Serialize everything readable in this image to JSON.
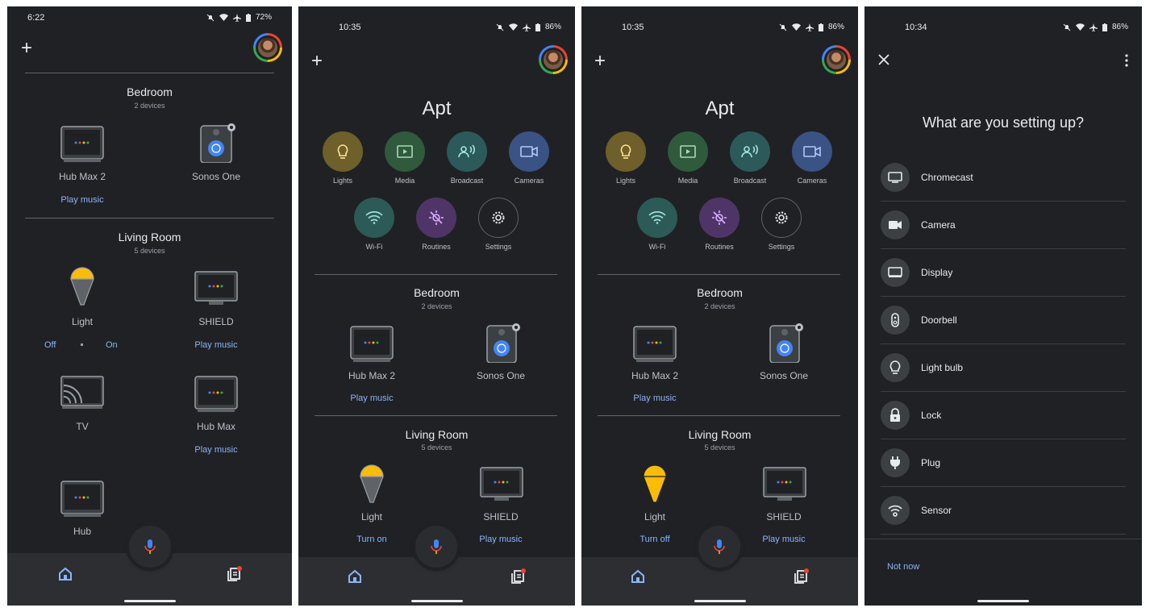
{
  "colors": {
    "bg": "#202124",
    "text": "#e8eaed",
    "muted": "#9aa0a6",
    "link": "#8ab4f8",
    "divider": "#5f6368",
    "nav": "#2d2e31"
  },
  "phone1": {
    "status": {
      "time": "6:22",
      "battery": "72%"
    },
    "rooms": [
      {
        "title": "Bedroom",
        "subtitle": "2 devices",
        "devices": [
          {
            "label": "Hub Max 2",
            "action": "Play music",
            "icon": "hub-display-icon"
          },
          {
            "label": "Sonos One",
            "action": "",
            "icon": "speaker-icon"
          }
        ]
      },
      {
        "title": "Living Room",
        "subtitle": "5 devices",
        "devices": [
          {
            "label": "Light",
            "off": "Off",
            "on": "On",
            "icon": "light-icon"
          },
          {
            "label": "SHIELD",
            "action": "Play music",
            "icon": "tv-box-icon"
          },
          {
            "label": "TV",
            "action": "",
            "icon": "cast-tv-icon"
          },
          {
            "label": "Hub Max",
            "action": "Play music",
            "icon": "hub-display-icon"
          },
          {
            "label": "Hub",
            "action": "",
            "icon": "hub-display-icon"
          }
        ]
      }
    ]
  },
  "phone2": {
    "status": {
      "time": "10:35",
      "battery": "86%"
    },
    "home_name": "Apt",
    "tiles": [
      {
        "label": "Lights",
        "color": "#7a6a2a",
        "icon": "bulb-icon"
      },
      {
        "label": "Media",
        "color": "#2e5a3c",
        "icon": "media-icon"
      },
      {
        "label": "Broadcast",
        "color": "#2a5a5a",
        "icon": "broadcast-icon"
      },
      {
        "label": "Cameras",
        "color": "#3a4f7a",
        "icon": "camera-icon"
      },
      {
        "label": "Wi-Fi",
        "color": "#2a5a56",
        "icon": "wifi-icon"
      },
      {
        "label": "Routines",
        "color": "#4e3466",
        "icon": "routines-icon"
      },
      {
        "label": "Settings",
        "color": "#202124",
        "icon": "gear-icon"
      }
    ],
    "bedroom": {
      "title": "Bedroom",
      "subtitle": "2 devices",
      "d1": "Hub Max 2",
      "d1_action": "Play music",
      "d2": "Sonos One"
    },
    "living": {
      "title": "Living Room",
      "subtitle": "5 devices",
      "d1": "Light",
      "d1_action": "Turn on",
      "d2": "SHIELD",
      "d2_action": "Play music"
    }
  },
  "phone3": {
    "status": {
      "time": "10:35",
      "battery": "86%"
    },
    "home_name": "Apt",
    "tiles": [
      {
        "label": "Lights"
      },
      {
        "label": "Media"
      },
      {
        "label": "Broadcast"
      },
      {
        "label": "Cameras"
      },
      {
        "label": "Wi-Fi"
      },
      {
        "label": "Routines"
      },
      {
        "label": "Settings"
      }
    ],
    "bedroom": {
      "title": "Bedroom",
      "subtitle": "2 devices",
      "d1": "Hub Max 2",
      "d1_action": "Play music",
      "d2": "Sonos One"
    },
    "living": {
      "title": "Living Room",
      "subtitle": "5 devices",
      "d1": "Light",
      "d1_action": "Turn off",
      "d2": "SHIELD",
      "d2_action": "Play music"
    }
  },
  "phone4": {
    "status": {
      "time": "10:34",
      "battery": "86%"
    },
    "heading": "What are you setting up?",
    "items": [
      {
        "label": "Chromecast",
        "icon": "tv-icon"
      },
      {
        "label": "Camera",
        "icon": "videocam-icon"
      },
      {
        "label": "Display",
        "icon": "display-icon"
      },
      {
        "label": "Doorbell",
        "icon": "doorbell-icon"
      },
      {
        "label": "Light bulb",
        "icon": "lightbulb-icon"
      },
      {
        "label": "Lock",
        "icon": "lock-icon"
      },
      {
        "label": "Plug",
        "icon": "plug-icon"
      },
      {
        "label": "Sensor",
        "icon": "sensor-icon"
      }
    ],
    "not_now": "Not now"
  }
}
